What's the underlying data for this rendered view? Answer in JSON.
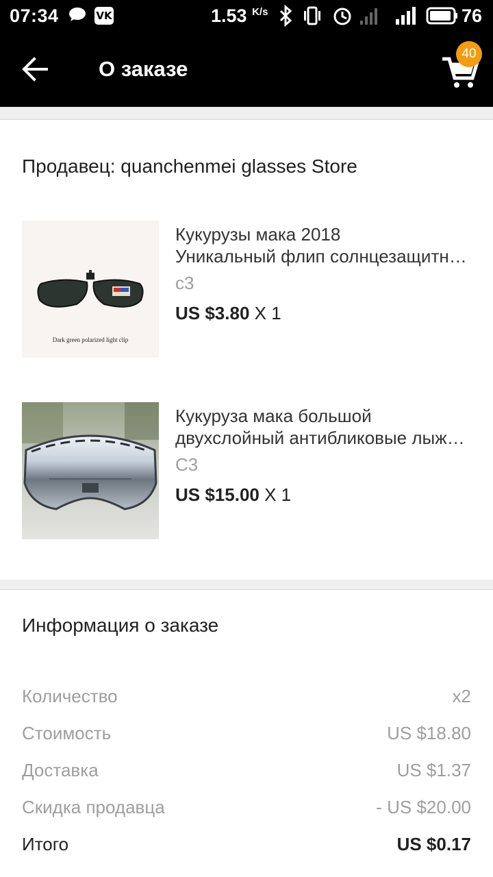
{
  "status_bar": {
    "time": "07:34",
    "vk_label": "VK",
    "speed_value": "1.53",
    "speed_unit": "K/s",
    "battery": "76"
  },
  "app_bar": {
    "title": "О заказе",
    "cart_count": "40"
  },
  "seller": {
    "text": "Продавец: quanchenmei glasses Store"
  },
  "items": [
    {
      "title_line1": "Кукурузы мака 2018",
      "title_line2": "Уникальный флип солнцезащитные очки",
      "sku": "c3",
      "price": "US $3.80",
      "qty": "X 1",
      "image_caption": "Dark green polarized light clip"
    },
    {
      "title_line1": "Кукуруза мака большой",
      "title_line2": "двухслойный антибликовые лыжные очки",
      "sku": "C3",
      "price": "US $15.00",
      "qty": "X 1"
    }
  ],
  "order_info": {
    "title": "Информация о заказе",
    "rows": [
      {
        "label": "Количество",
        "value": "x2"
      },
      {
        "label": "Стоимость",
        "value": "US $18.80"
      },
      {
        "label": "Доставка",
        "value": "US $1.37"
      },
      {
        "label": "Скидка продавца",
        "value": "- US $20.00"
      }
    ],
    "total_label": "Итого",
    "total_value": "US $0.17"
  },
  "colors": {
    "bar_bg": "#000000",
    "badge": "#f39c12",
    "muted_text": "#9e9e9e"
  },
  "icons": [
    "chat-icon",
    "vk-icon",
    "bluetooth-icon",
    "vibrate-icon",
    "alarm-icon",
    "signal-icon",
    "battery-icon",
    "back-arrow-icon",
    "cart-icon"
  ]
}
